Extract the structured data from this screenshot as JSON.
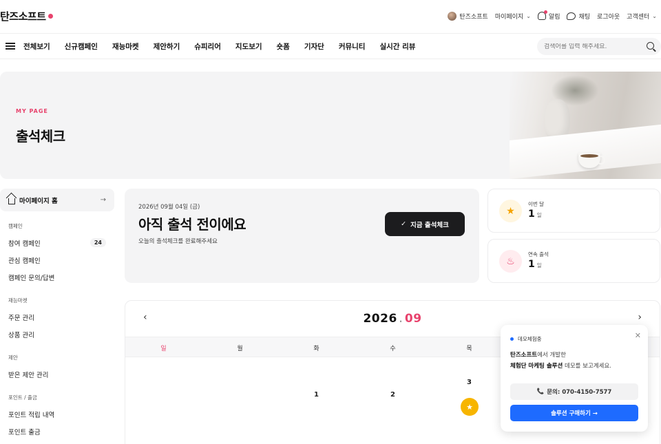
{
  "brand": {
    "name": "탄즈소프트",
    "accent": "#e8436d",
    "blue": "#1e6bff"
  },
  "util_bar": {
    "user": "탄즈소프트",
    "mypage": "마이페이지",
    "alerts": "알림",
    "chat": "채팅",
    "logout": "로그아웃",
    "support": "고객센터"
  },
  "nav": {
    "all_menu": "전체보기",
    "items": [
      "신규캠페인",
      "재능마켓",
      "제안하기",
      "슈피리어",
      "지도보기",
      "숏폼",
      "기자단",
      "커뮤니티",
      "실시간 리뷰"
    ],
    "search_placeholder": "검색어를 입력 해주세요."
  },
  "hero": {
    "eyebrow": "MY PAGE",
    "title": "출석체크"
  },
  "sidebar": {
    "home": "마이페이지 홈",
    "groups": [
      {
        "title": "캠페인",
        "items": [
          {
            "label": "참여 캠페인",
            "count": "24"
          },
          {
            "label": "관심 캠페인"
          },
          {
            "label": "캠페인 문의/답변"
          }
        ]
      },
      {
        "title": "재능마켓",
        "items": [
          {
            "label": "주문 관리"
          },
          {
            "label": "상품 관리"
          }
        ]
      },
      {
        "title": "제안",
        "items": [
          {
            "label": "받은 제안 관리"
          }
        ]
      },
      {
        "title": "포인트 / 출금",
        "items": [
          {
            "label": "포인트 적립 내역"
          },
          {
            "label": "포인트 출금"
          }
        ]
      }
    ]
  },
  "checkin": {
    "date": "2026년 09월 04일 (금)",
    "title": "아직 출석 전이에요",
    "subtitle": "오늘의 출석체크를 완료해주세요",
    "button": "지금 출석체크"
  },
  "stats": {
    "month": {
      "label": "이번 달",
      "value": "1",
      "unit": "일"
    },
    "streak": {
      "label": "연속 출석",
      "value": "1",
      "unit": "일"
    }
  },
  "calendar": {
    "year": "2026",
    "sep": ".",
    "month": "09",
    "weekdays": [
      "일",
      "월",
      "화",
      "수",
      "목"
    ],
    "days": {
      "tue": "1",
      "wed": "2",
      "thu": "3"
    },
    "prev": "‹",
    "next": "›"
  },
  "popup": {
    "tag": "데모체험중",
    "line1_bold": "탄즈소프트",
    "line1_rest": "에서 개발한",
    "line2_bold": "체험단 마케팅 솔루션",
    "line2_rest": " 데모를 보고계세요.",
    "call": "문의: 070-4150-7577",
    "buy": "솔루션 구매하기 →"
  }
}
